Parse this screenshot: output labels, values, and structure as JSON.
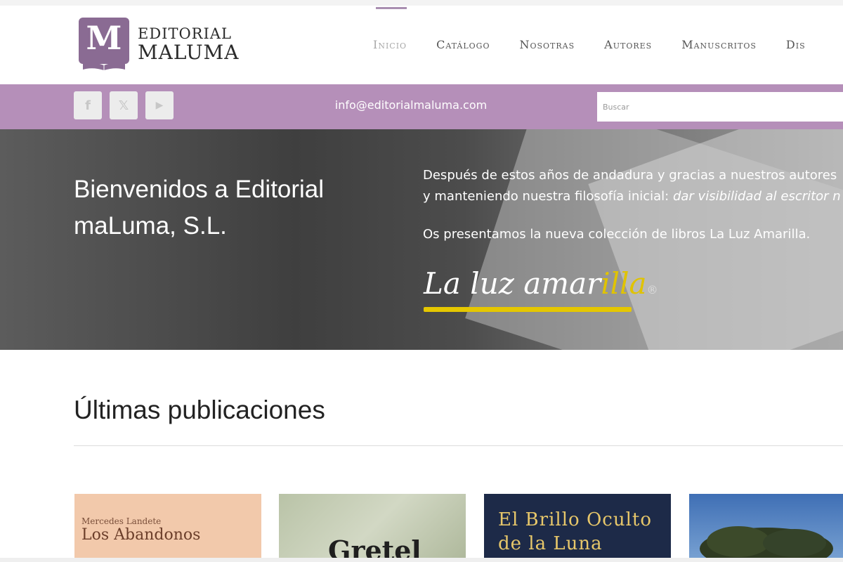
{
  "header": {
    "logo_letter": "M",
    "logo_line1": "EDITORIAL",
    "logo_line2": "MALUMA",
    "nav": [
      "Inicio",
      "Catálogo",
      "Nosotras",
      "Autores",
      "Manuscritos",
      "Dis"
    ]
  },
  "topbar": {
    "social": [
      "f",
      "𝕏",
      "▶"
    ],
    "social_icons": [
      "facebook-icon",
      "x-twitter-icon",
      "youtube-icon"
    ],
    "email": "info@editorialmaluma.com",
    "search_placeholder": "Buscar"
  },
  "hero": {
    "title": "Bienvenidos a Editorial maLuma, S.L.",
    "p1_line1": "Después de estos años de andadura y gracias a nuestros autores",
    "p1_line2_plain": "y manteniendo nuestra filosofía inicial: ",
    "p1_line2_italic": "dar visibilidad al escritor n",
    "p2": "Os presentamos la nueva colección de libros La Luz Amarilla.",
    "collection_logo_pre": "La luz amar",
    "collection_logo_accent": "i",
    "collection_logo_post": "lla",
    "collection_logo_reg": "®"
  },
  "latest": {
    "title": "Últimas publicaciones",
    "books": [
      {
        "author": "Mercedes Landete",
        "title": "Los Abandonos"
      },
      {
        "title": "Gretel"
      },
      {
        "title": "El Brillo Oculto de la Luna"
      },
      {
        "title": ""
      }
    ]
  },
  "colors": {
    "brand_purple": "#b58fb9",
    "logo_purple": "#8a6b93",
    "accent_yellow": "#e5c700"
  }
}
